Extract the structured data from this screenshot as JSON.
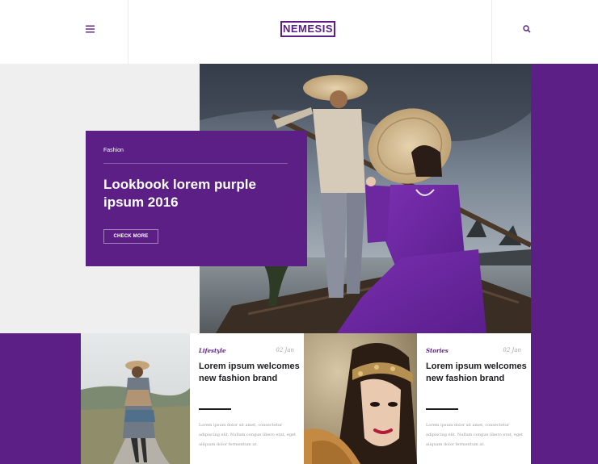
{
  "header": {
    "logo_text": "NEMESIS",
    "menu_icon": "hamburger-menu-icon",
    "search_icon": "search-icon"
  },
  "colors": {
    "brand_purple": "#5b1f86",
    "light_gray": "#efefef",
    "text_dark": "#1c1c22",
    "text_muted": "#9a9a9a"
  },
  "hero": {
    "category": "Fashion",
    "title": "Lookbook lorem purple ipsum 2016",
    "cta_label": "CHECK MORE"
  },
  "cards": [
    {
      "category": "Lifestyle",
      "date": "02 Jan",
      "title": "Lorem ipsum welcomes new fashion brand",
      "excerpt": "Lorem ipsum dolor sit amet, consectetur adipiscing elit. Nullam congue libero erat, eget aliquam dolor fermentum at."
    },
    {
      "category": "Stories",
      "date": "02 Jan",
      "title": "Lorem ipsum welcomes new fashion brand",
      "excerpt": "Lorem ipsum dolor sit amet, consectetur adipiscing elit. Nullam congue libero erat, eget aliquam dolor fermentum at."
    }
  ]
}
